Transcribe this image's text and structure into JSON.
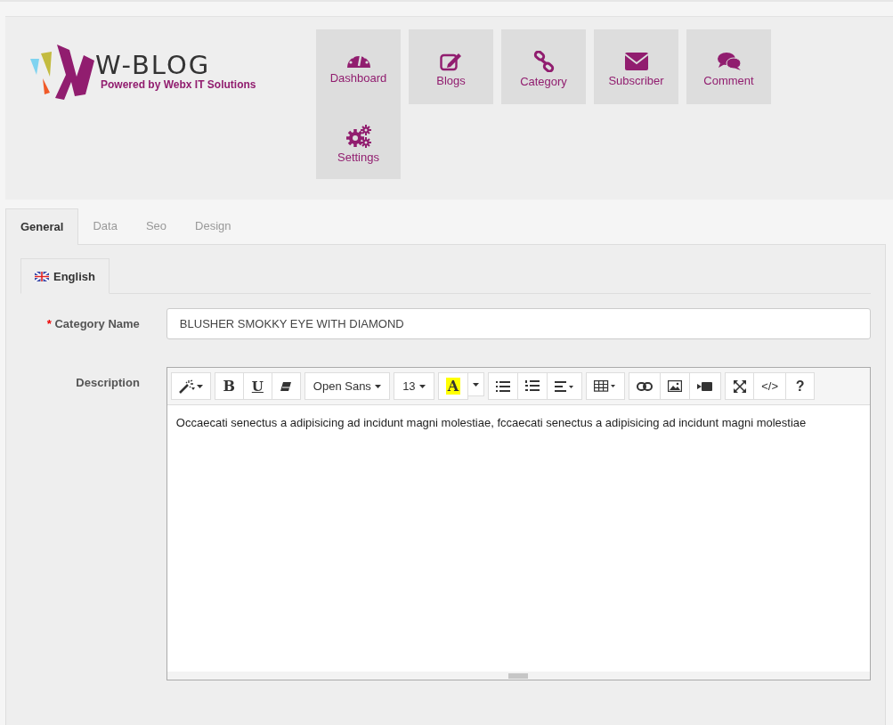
{
  "logo": {
    "title": "W-BLOG",
    "tagline": "Powered by Webx IT Solutions"
  },
  "nav": [
    {
      "label": "Dashboard",
      "kind": "dashboard"
    },
    {
      "label": "Blogs",
      "kind": "edit"
    },
    {
      "label": "Category",
      "kind": "link"
    },
    {
      "label": "Subscriber",
      "kind": "mail"
    },
    {
      "label": "Comment",
      "kind": "comment"
    },
    {
      "label": "Settings",
      "kind": "gears"
    }
  ],
  "tabs": [
    {
      "label": "General",
      "selected": true
    },
    {
      "label": "Data",
      "selected": false
    },
    {
      "label": "Seo",
      "selected": false
    },
    {
      "label": "Design",
      "selected": false
    }
  ],
  "language_tabs": [
    {
      "label": "English",
      "selected": true
    }
  ],
  "fields": [
    {
      "kind": "text",
      "label": "Category Name",
      "required_mark": "*",
      "value": "BLUSHER SMOKKY EYE WITH DIAMOND"
    },
    {
      "kind": "editor",
      "label": "Description",
      "value": "Occaecati senectus a adipisicing ad incidunt magni molestiae, fccaecati senectus a adipisicing ad incidunt magni molestiae",
      "toolbar": [
        [
          {
            "kind": "magic"
          }
        ],
        [
          {
            "kind": "bold",
            "text": "B"
          },
          {
            "kind": "underline",
            "text": "U"
          },
          {
            "kind": "eraser"
          }
        ],
        [
          {
            "kind": "font",
            "text": "Open Sans"
          }
        ],
        [
          {
            "kind": "size",
            "text": "13"
          }
        ],
        [
          {
            "kind": "color",
            "text": "A"
          },
          {
            "kind": "caret"
          }
        ],
        [
          {
            "kind": "bullets"
          },
          {
            "kind": "numbers"
          },
          {
            "kind": "align"
          }
        ],
        [
          {
            "kind": "table"
          }
        ],
        [
          {
            "kind": "link"
          },
          {
            "kind": "image"
          },
          {
            "kind": "video"
          }
        ],
        [
          {
            "kind": "fullscreen"
          },
          {
            "kind": "code",
            "text": "</>"
          },
          {
            "kind": "help",
            "text": "?"
          }
        ]
      ]
    }
  ]
}
